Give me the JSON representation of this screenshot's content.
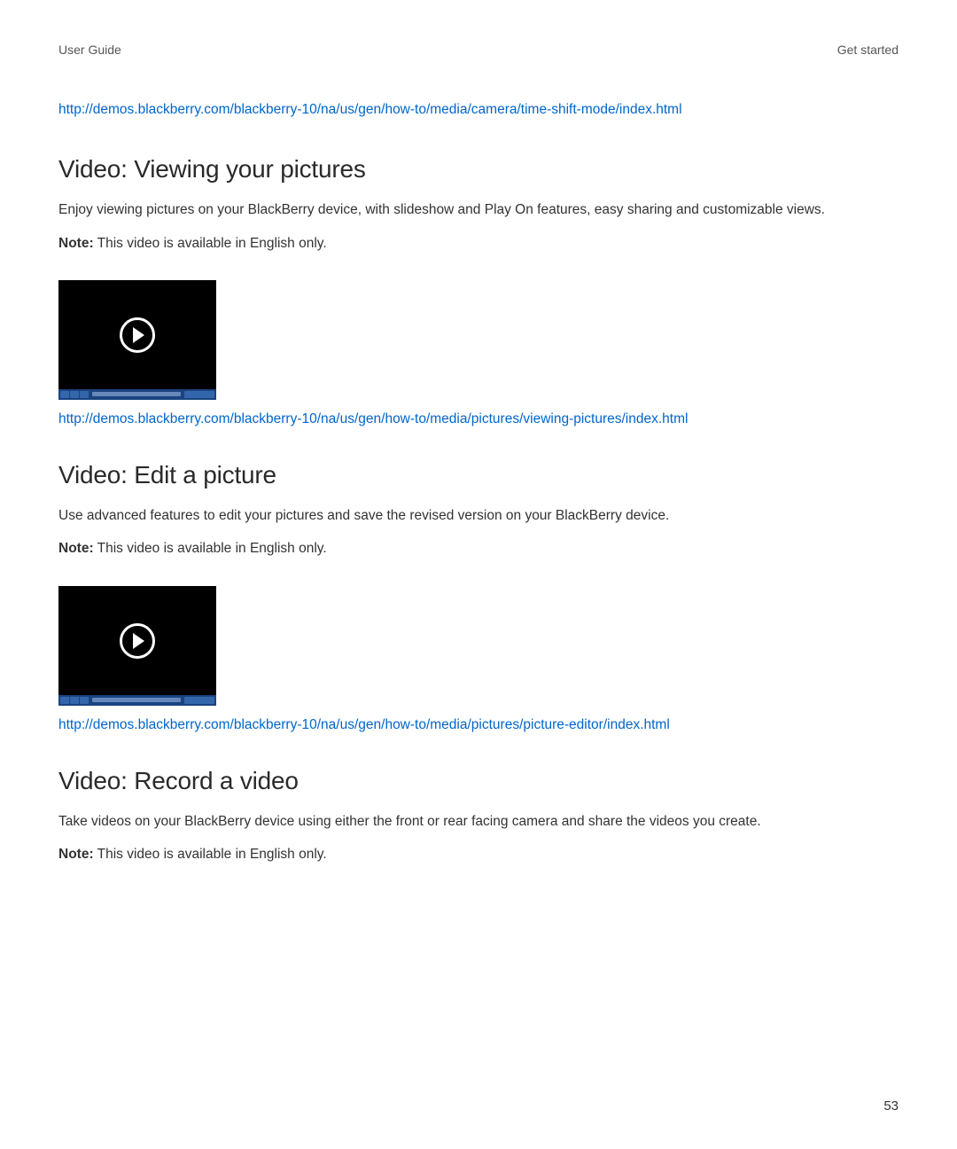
{
  "header": {
    "left": "User Guide",
    "right": "Get started"
  },
  "topLink": "http://demos.blackberry.com/blackberry-10/na/us/gen/how-to/media/camera/time-shift-mode/index.html",
  "sections": [
    {
      "heading": "Video: Viewing your pictures",
      "body": "Enjoy viewing pictures on your BlackBerry device, with slideshow and Play On features, easy sharing and customizable views.",
      "noteLabel": "Note:",
      "note": " This video is available in English only.",
      "link": "http://demos.blackberry.com/blackberry-10/na/us/gen/how-to/media/pictures/viewing-pictures/index.html"
    },
    {
      "heading": "Video: Edit a picture",
      "body": "Use advanced features to edit your pictures and save the revised version on your BlackBerry device.",
      "noteLabel": "Note:",
      "note": " This video is available in English only.",
      "link": "http://demos.blackberry.com/blackberry-10/na/us/gen/how-to/media/pictures/picture-editor/index.html"
    },
    {
      "heading": "Video: Record a video",
      "body": "Take videos on your BlackBerry device using either the front or rear facing camera and share the videos you create.",
      "noteLabel": "Note:",
      "note": " This video is available in English only.",
      "link": ""
    }
  ],
  "pageNumber": "53"
}
